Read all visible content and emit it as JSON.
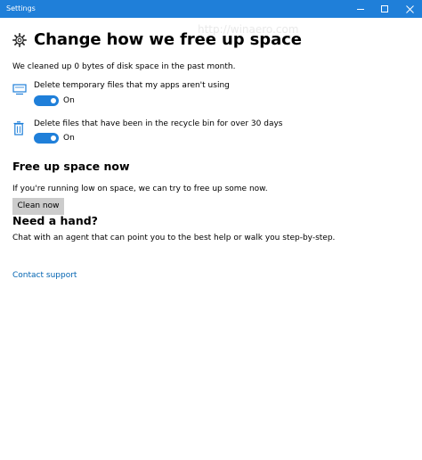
{
  "window": {
    "title": "Settings"
  },
  "page": {
    "title": "Change how we free up space"
  },
  "storage_sense": {
    "cleaned_summary": "We cleaned up 0 bytes of disk space in the past month.",
    "temp_files": {
      "label": "Delete temporary files that my apps aren't using",
      "toggle_state": "On"
    },
    "recycle_bin": {
      "label": "Delete files that have been in the recycle bin for over 30 days",
      "toggle_state": "On"
    }
  },
  "free_up": {
    "heading": "Free up space now",
    "description": "If you're running low on space, we can try to free up some now.",
    "button_label": "Clean now"
  },
  "help": {
    "heading": "Need a hand?",
    "description": "Chat with an agent that can point you to the best help or walk you step-by-step.",
    "link_label": "Contact support"
  },
  "colors": {
    "accent": "#1f7fd9",
    "link": "#0063b1",
    "button_bg": "#cccccc"
  },
  "watermark": {
    "text": "http://winaero.com"
  }
}
